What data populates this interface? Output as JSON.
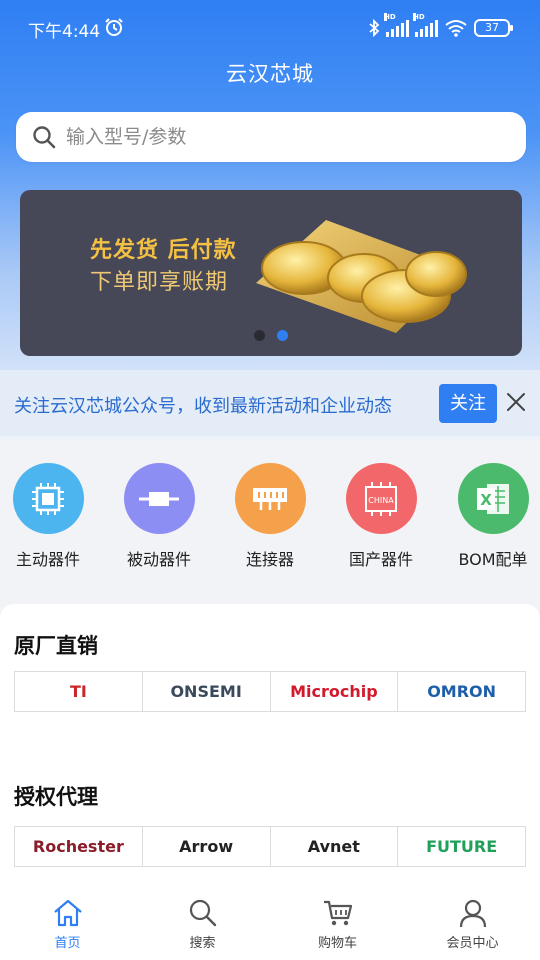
{
  "status_bar": {
    "time": "下午4:44",
    "battery": "37",
    "signal_label": "HD"
  },
  "header": {
    "title": "云汉芯城"
  },
  "search": {
    "placeholder": "输入型号/参数",
    "value": ""
  },
  "banner": {
    "line1": "先发货 后付款",
    "line2": "下单即享账期",
    "page_count": 2,
    "active_page": 2
  },
  "notice": {
    "text": "关注云汉芯城公众号，收到最新活动和企业动态",
    "follow_label": "关注"
  },
  "categories": [
    {
      "label": "主动器件",
      "icon": "chip-icon",
      "color": "#4cb4ef"
    },
    {
      "label": "被动器件",
      "icon": "resistor-icon",
      "color": "#8c8ef3"
    },
    {
      "label": "连接器",
      "icon": "connector-icon",
      "color": "#f5a04a"
    },
    {
      "label": "国产器件",
      "icon": "china-chip-icon",
      "color": "#f2686a",
      "badge": "CHINA"
    },
    {
      "label": "BOM配单",
      "icon": "excel-icon",
      "color": "#4cba6c",
      "badge": "X"
    }
  ],
  "sections": {
    "factory_direct": {
      "title": "原厂直销",
      "brands": [
        {
          "name": "TI",
          "color": "#c8262b"
        },
        {
          "name": "ONSEMI",
          "color": "#3a4a5c"
        },
        {
          "name": "Microchip",
          "color": "#d3192c"
        },
        {
          "name": "OMRON",
          "color": "#1f5ea8"
        }
      ]
    },
    "authorized": {
      "title": "授权代理",
      "brands": [
        {
          "name": "Rochester",
          "color": "#8a1d2a"
        },
        {
          "name": "Arrow",
          "color": "#222222"
        },
        {
          "name": "Avnet",
          "color": "#222222"
        },
        {
          "name": "FUTURE",
          "color": "#1fa15a"
        }
      ]
    }
  },
  "tabbar": [
    {
      "label": "首页",
      "icon": "home-icon",
      "active": true
    },
    {
      "label": "搜索",
      "icon": "search-icon",
      "active": false
    },
    {
      "label": "购物车",
      "icon": "cart-icon",
      "active": false
    },
    {
      "label": "会员中心",
      "icon": "user-icon",
      "active": false
    }
  ],
  "colors": {
    "primary": "#2f7ff3",
    "banner_bg": "#464857",
    "gold": "#f5c144"
  }
}
